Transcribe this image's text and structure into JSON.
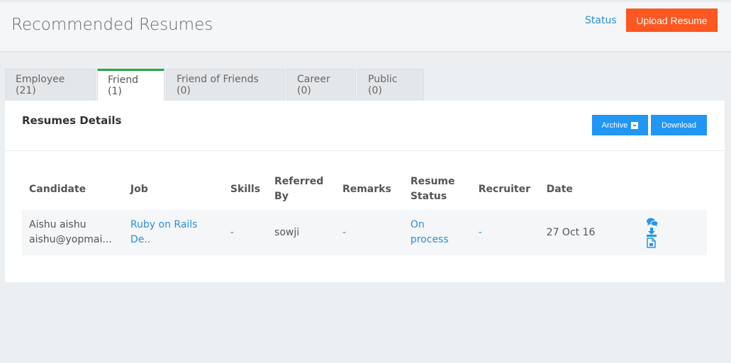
{
  "header": {
    "title": "Recommended Resumes",
    "status_link": "Status",
    "upload_button": "Upload Resume"
  },
  "tabs": [
    {
      "label": "Employee (21)",
      "active": false
    },
    {
      "label": "Friend (1)",
      "active": true
    },
    {
      "label": "Friend of Friends (0)",
      "active": false
    },
    {
      "label": "Career (0)",
      "active": false
    },
    {
      "label": "Public (0)",
      "active": false
    }
  ],
  "panel": {
    "title": "Resumes Details",
    "archive_button": "Archive",
    "download_button": "Download"
  },
  "table": {
    "columns": [
      "Candidate",
      "Job",
      "Skills",
      "Referred By",
      "Remarks",
      "Resume Status",
      "Recruiter",
      "Date"
    ],
    "rows": [
      {
        "candidate_name": "Aishu aishu",
        "candidate_email": "aishu@yopmai...",
        "job": "Ruby on Rails De..",
        "skills": "-",
        "referred_by": "sowji",
        "remarks": "-",
        "resume_status": "On process",
        "recruiter": "-",
        "date": "27 Oct 16",
        "actions": [
          "comments-icon",
          "download-icon",
          "document-icon"
        ]
      }
    ]
  },
  "colors": {
    "accent": "#2196f3",
    "upload": "#fe5722",
    "active_tab": "#28a745",
    "link": "#2a8fd6"
  }
}
